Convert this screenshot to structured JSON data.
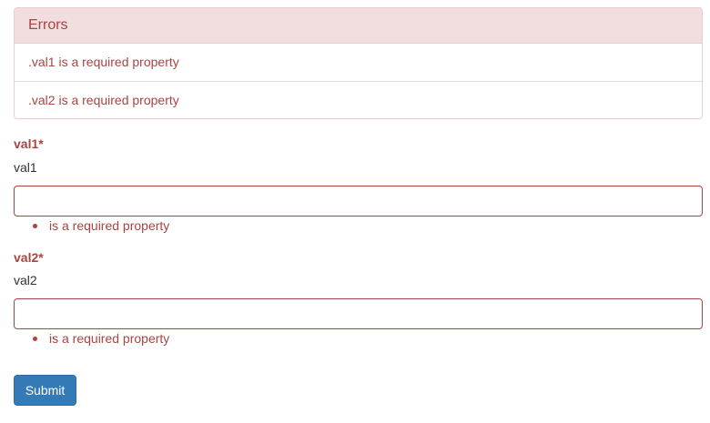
{
  "errors_panel": {
    "title": "Errors",
    "items": [
      ".val1 is a required property",
      ".val2 is a required property"
    ]
  },
  "fields": [
    {
      "label": "val1*",
      "description": "val1",
      "value": "",
      "error": "is a required property"
    },
    {
      "label": "val2*",
      "description": "val2",
      "value": "",
      "error": "is a required property"
    }
  ],
  "submit_label": "Submit",
  "colors": {
    "error": "#a94442",
    "primary": "#337ab7"
  }
}
